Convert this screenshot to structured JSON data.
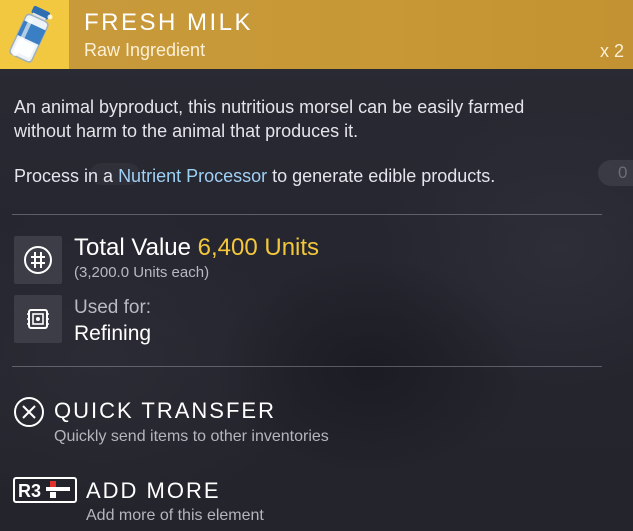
{
  "item": {
    "name": "FRESH MILK",
    "category": "Raw Ingredient",
    "quantity": "x 2",
    "icon": "milk-bottle-icon",
    "accent_color": "#c99a3c",
    "icon_bg_color": "#f2c840"
  },
  "description": {
    "text": "An animal byproduct, this nutritious morsel can be easily farmed without harm to the animal that produces it.",
    "process_prefix": "Process in a",
    "process_link": "Nutrient Processor",
    "process_suffix": "to generate edible products."
  },
  "background": {
    "ghost_text": "0"
  },
  "stats": {
    "total_value_label": "Total Value",
    "total_value_amount": "6,400 Units",
    "each_text": "(3,200.0 Units each)",
    "value_icon": "units-currency-icon",
    "used_for_label": "Used for:",
    "used_for_value": "Refining",
    "used_for_icon": "refiner-icon",
    "highlight_color": "#f2c73b"
  },
  "actions": [
    {
      "button": "cross-button-icon",
      "title": "QUICK TRANSFER",
      "subtitle": "Quickly send items to other inventories"
    },
    {
      "button": "r3-button-icon",
      "button_label": "R3",
      "title": "ADD MORE",
      "subtitle": "Add more of this element"
    }
  ]
}
